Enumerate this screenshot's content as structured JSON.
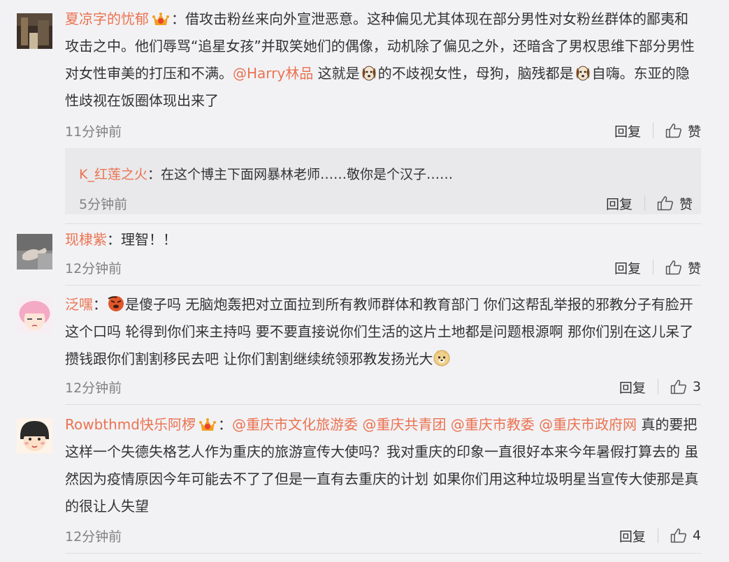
{
  "comments": [
    {
      "user": "夏凉字的忧郁",
      "avatar_icon": "dark-portrait-avatar",
      "has_badge": true,
      "text_parts": [
        "：借攻击粉丝来向外宣泄恶意。这种偏见尤其体现在部分男性对女粉丝群体的鄙夷和攻击之中。他们辱骂“追星女孩”并取笑她们的偶像，动机除了偏见之外，还暗含了男权思维下部分男性对女性审美的打压和不满。",
        "@Harry林品",
        " 这就是",
        "的不歧视女性，母狗，脑残都是",
        "自嗨。东亚的隐性歧视在饭圈体现出来了"
      ],
      "time": "11分钟前",
      "reply_label": "回复",
      "like_label": "赞",
      "subreply": {
        "user": "K_红莲之火",
        "text": "：在这个博主下面网暴林老师……敬你是个汉子……",
        "time": "5分钟前",
        "reply_label": "回复",
        "like_label": "赞"
      }
    },
    {
      "user": "现棣紫",
      "avatar_icon": "hand-photo-avatar",
      "text": "：理智！！",
      "time": "12分钟前",
      "reply_label": "回复",
      "like_label": "赞"
    },
    {
      "user": "泛嘿",
      "avatar_icon": "anime-girl-avatar",
      "text_parts": [
        "：",
        "是傻子吗 无脑炮轰把对立面拉到所有教师群体和教育部门 你们这帮乱举报的邪教分子有脸开这个口吗 轮得到你们来主持吗 要不要直接说你们生活的这片土地都是问题根源啊 那你们别在这儿呆了 攒钱跟你们割割移民去吧 让你们割割继续统领邪教发扬光大"
      ],
      "time": "12分钟前",
      "reply_label": "回复",
      "like_count": "3"
    },
    {
      "user": "Rowbthmd快乐阿椤",
      "avatar_icon": "maruko-avatar",
      "has_badge": true,
      "text_parts": [
        "：",
        "@重庆市文化旅游委",
        " ",
        "@重庆共青团",
        " ",
        "@重庆市教委",
        " ",
        "@重庆市政府网",
        " 真的要把这样一个失德失格艺人作为重庆的旅游宣传大使吗？我对重庆的印象一直很好本来今年暑假打算去的 虽然因为疫情原因今年可能去不了了但是一直有去重庆的计划 如果你们用这种垃圾明星当宣传大使那是真的很让人失望"
      ],
      "time": "12分钟前",
      "reply_label": "回复",
      "like_count": "4"
    }
  ],
  "colors": {
    "username": "#eb7350",
    "background": "#f2f2f5",
    "subreply_bg": "#e9e9ec",
    "meta": "#808080"
  }
}
